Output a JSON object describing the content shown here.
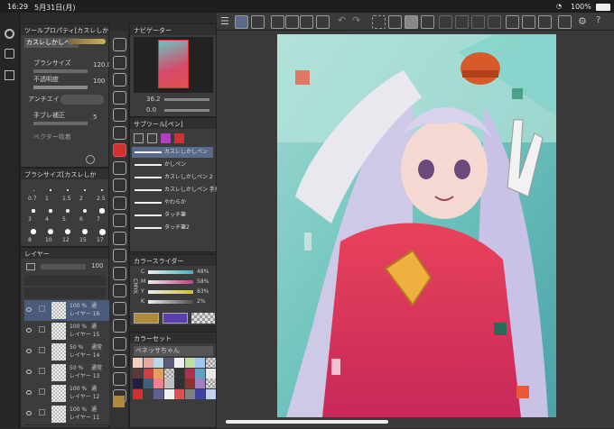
{
  "status": {
    "time": "16:29",
    "date": "5月31日(月)",
    "battery": "100%"
  },
  "tool_property": {
    "title": "ツールプロパティ[カスレしかし",
    "current_tool": "カスレしかしペン",
    "brush_size_label": "ブラシサイズ",
    "brush_size_value": "120.0",
    "opacity_label": "不透明度",
    "opacity_value": "100",
    "antialias_label": "アンチエイ",
    "stabilization_label": "手ブレ補正",
    "stabilization_value": "5",
    "vector_label": "ベクター吸着"
  },
  "brush_size_panel": {
    "title": "ブラシサイズ[カスレしか",
    "sizes": [
      "0.7",
      "1",
      "1.5",
      "2",
      "2.5",
      "3",
      "4",
      "5",
      "6",
      "7",
      "8",
      "10",
      "12",
      "15",
      "17"
    ]
  },
  "layer_panel": {
    "title": "レイヤー",
    "opacity_value": "100",
    "layers": [
      {
        "percent": "100 %",
        "mode": "通",
        "name": "レイヤー 16"
      },
      {
        "percent": "100 %",
        "mode": "通",
        "name": "レイヤー 15"
      },
      {
        "percent": "50 %",
        "mode": "通常",
        "name": "レイヤー 14"
      },
      {
        "percent": "50 %",
        "mode": "通常",
        "name": "レイヤー 13"
      },
      {
        "percent": "100 %",
        "mode": "通",
        "name": "レイヤー 12"
      },
      {
        "percent": "100 %",
        "mode": "通",
        "name": "レイヤー 11"
      }
    ]
  },
  "navigator": {
    "title": "ナビゲーター",
    "zoom": "36.2",
    "rotation": "0.0"
  },
  "subtool": {
    "title": "サブツール[ペン]",
    "brushes": [
      "カスレしかしペン",
      "かしペン",
      "カスレしかしペン 2",
      "カスレしかしペン 手振れ補正",
      "やわらか",
      "タッチ筆",
      "タッチ筆2"
    ]
  },
  "color_slider": {
    "title": "カラースライダー",
    "channels": [
      {
        "name": "C",
        "value": "48%"
      },
      {
        "name": "M",
        "value": "58%"
      },
      {
        "name": "Y",
        "value": "83%"
      },
      {
        "name": "K",
        "value": "2%"
      }
    ],
    "mode_label": "CMYK"
  },
  "color_set": {
    "title": "カラーセット",
    "set_name": "ベネッサちゃん"
  },
  "colors": {
    "main": "#b08a3a",
    "sub": "#5a3fb0",
    "accent": "#d23a2a"
  },
  "icons": [
    "menu-icon",
    "select-icon",
    "search-icon",
    "undo-icon",
    "redo-icon",
    "settings-icon",
    "help-icon"
  ]
}
